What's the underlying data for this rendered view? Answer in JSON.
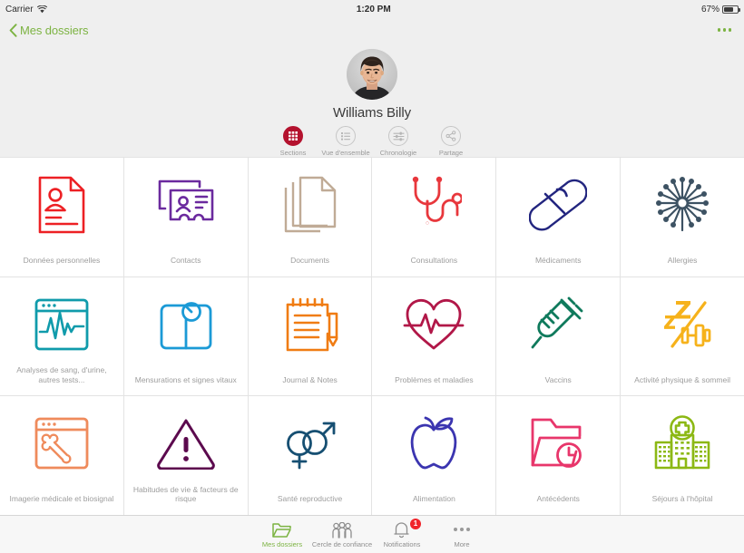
{
  "statusbar": {
    "carrier": "Carrier",
    "wifi_icon": "wifi-icon",
    "time": "1:20 PM",
    "battery_percent": "67%",
    "battery_level": 67
  },
  "navbar": {
    "back_label": "Mes dossiers",
    "back_icon": "chevron-left-icon",
    "more_icon": "more-horizontal-icon",
    "accent_color": "#7cb342"
  },
  "profile": {
    "avatar_name": "avatar",
    "name": "Williams Billy",
    "segments": [
      {
        "label": "Sections",
        "icon": "grid-icon",
        "active": true
      },
      {
        "label": "Vue d'ensemble",
        "icon": "list-icon",
        "active": false
      },
      {
        "label": "Chronologie",
        "icon": "timeline-sliders-icon",
        "active": false
      },
      {
        "label": "Partage",
        "icon": "share-icon",
        "active": false
      }
    ],
    "active_color": "#b4122e"
  },
  "grid": {
    "items": [
      {
        "label": "Données personnelles",
        "icon": "document-person-icon",
        "color": "#ed2024"
      },
      {
        "label": "Contacts",
        "icon": "contact-cards-icon",
        "color": "#6b2a9e"
      },
      {
        "label": "Documents",
        "icon": "stacked-papers-icon",
        "color": "#c0ab96"
      },
      {
        "label": "Consultations",
        "icon": "stethoscope-icon",
        "color": "#e8373c"
      },
      {
        "label": "Médicaments",
        "icon": "pill-capsule-icon",
        "color": "#22257f"
      },
      {
        "label": "Allergies",
        "icon": "pollen-dandelion-icon",
        "color": "#3d5263"
      },
      {
        "label": "Analyses de sang, d'urine, autres tests...",
        "icon": "lab-ecg-window-icon",
        "color": "#109bab"
      },
      {
        "label": "Mensurations et signes vitaux",
        "icon": "weight-scale-icon",
        "color": "#1b9ad6"
      },
      {
        "label": "Journal & Notes",
        "icon": "notepad-pencil-icon",
        "color": "#f07c13"
      },
      {
        "label": "Problèmes et maladies",
        "icon": "heart-pulse-icon",
        "color": "#b11748"
      },
      {
        "label": "Vaccins",
        "icon": "syringe-icon",
        "color": "#0f7a5c"
      },
      {
        "label": "Activité physique & sommeil",
        "icon": "sleep-dumbbell-icon",
        "color": "#f6b21b"
      },
      {
        "label": "Imagerie médicale et biosignal",
        "icon": "xray-bone-window-icon",
        "color": "#ef8b5c"
      },
      {
        "label": "Habitudes de vie & facteurs de risque",
        "icon": "warning-triangle-icon",
        "color": "#5c0a4e"
      },
      {
        "label": "Santé reproductive",
        "icon": "gender-symbols-icon",
        "color": "#164f72"
      },
      {
        "label": "Alimentation",
        "icon": "apple-icon",
        "color": "#3b35b0"
      },
      {
        "label": "Antécédents",
        "icon": "folder-clock-icon",
        "color": "#e8366b"
      },
      {
        "label": "Séjours à l'hôpital",
        "icon": "hospital-building-icon",
        "color": "#8cb814"
      }
    ]
  },
  "tabbar": {
    "tabs": [
      {
        "label": "Mes dossiers",
        "icon": "folder-icon",
        "active": true,
        "badge": null
      },
      {
        "label": "Cercle de confiance",
        "icon": "people-group-icon",
        "active": false,
        "badge": null
      },
      {
        "label": "Notifications",
        "icon": "bell-icon",
        "active": false,
        "badge": "1"
      },
      {
        "label": "More",
        "icon": "more-horizontal-icon",
        "active": false,
        "badge": null
      }
    ],
    "active_color": "#7cb342",
    "badge_color": "#f0242a"
  }
}
